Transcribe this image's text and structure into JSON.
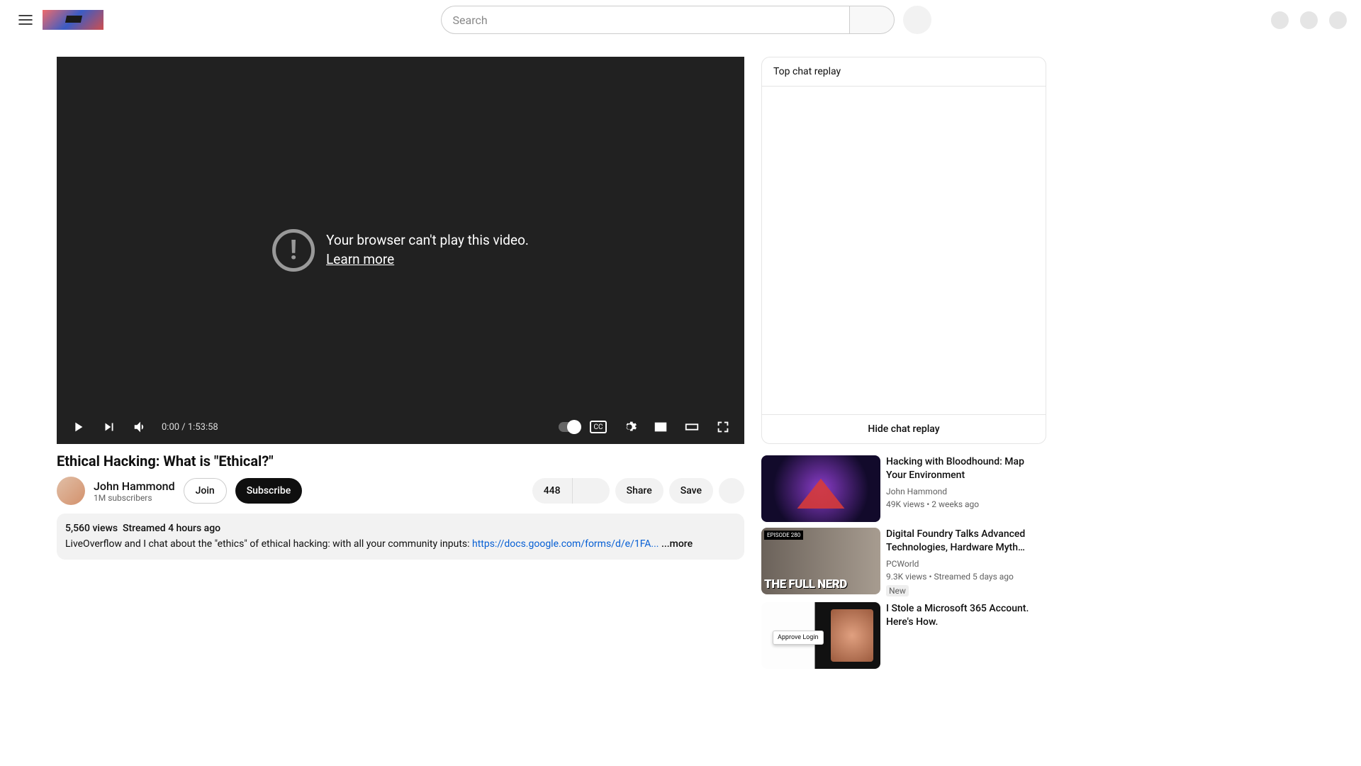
{
  "header": {
    "search_placeholder": "Search"
  },
  "player": {
    "error_line1": "Your browser can't play this video.",
    "error_link": "Learn more",
    "time": "0:00 / 1:53:58",
    "cc_label": "CC"
  },
  "video": {
    "title": "Ethical Hacking: What is \"Ethical?\"",
    "channel": "John Hammond",
    "subs": "1M subscribers",
    "join": "Join",
    "subscribe": "Subscribe",
    "likes": "448",
    "share": "Share",
    "save": "Save"
  },
  "desc": {
    "views": "5,560 views",
    "when": "Streamed 4 hours ago",
    "body": "LiveOverflow and I chat about the \"ethics\" of ethical hacking: with all your community inputs: ",
    "link": "https://docs.google.com/forms/d/e/1FA...",
    "more": " ...more"
  },
  "chat": {
    "head": "Top chat replay",
    "foot": "Hide chat replay"
  },
  "recs": [
    {
      "title": "Hacking with Bloodhound: Map Your Environment",
      "channel": "John Hammond",
      "meta": "49K views  • 2 weeks ago",
      "badge": ""
    },
    {
      "title": "Digital Foundry Talks Advanced Technologies, Hardware Myth…",
      "channel": "PCWorld",
      "meta": "9.3K views  • Streamed 5 days ago",
      "badge": "New"
    },
    {
      "title": "I Stole a Microsoft 365 Account. Here's How.",
      "channel": "",
      "meta": "",
      "badge": ""
    }
  ]
}
